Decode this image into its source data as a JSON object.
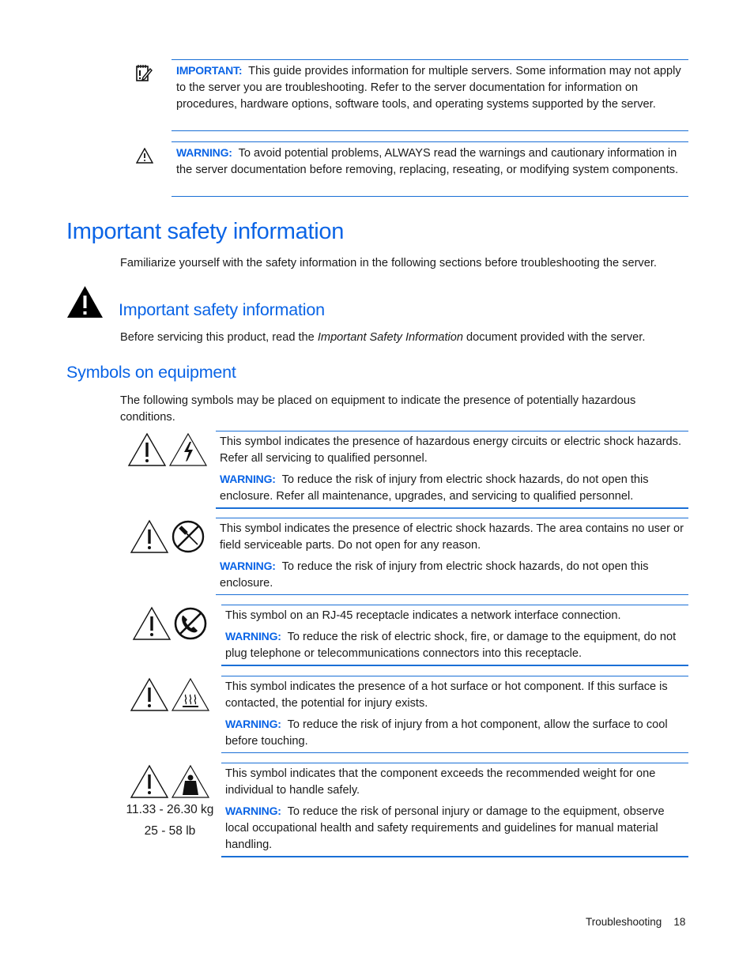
{
  "notes": [
    {
      "icon": "important-note-icon",
      "label": "IMPORTANT:",
      "text": "This guide provides information for multiple servers. Some information may not apply to the server you are troubleshooting. Refer to the server documentation for information on procedures, hardware options, software tools, and operating systems supported by the server."
    },
    {
      "icon": "warning-triangle-icon",
      "label": "WARNING:",
      "text": "To avoid potential problems, ALWAYS read the warnings and cautionary information in the server documentation before removing, replacing, reseating, or modifying system components."
    }
  ],
  "section": {
    "title": "Important safety information",
    "intro": "Familiarize yourself with the safety information in the following sections before troubleshooting the server."
  },
  "subsection_safety": {
    "title": "Important safety information",
    "text_before": "Before servicing this product, read the ",
    "text_italic": "Important Safety Information",
    "text_after": " document provided with the server."
  },
  "subsection_symbols": {
    "title": "Symbols on equipment",
    "intro": "The following symbols may be placed on equipment to indicate the presence of potentially hazardous conditions.",
    "items": [
      {
        "icons": [
          "exclamation-triangle-icon",
          "lightning-triangle-icon"
        ],
        "description": "This symbol indicates the presence of hazardous energy circuits or electric shock hazards. Refer all servicing to qualified personnel.",
        "warning_label": "WARNING:",
        "warning_text": "To reduce the risk of injury from electric shock hazards, do not open this enclosure. Refer all maintenance, upgrades, and servicing to qualified personnel."
      },
      {
        "icons": [
          "exclamation-triangle-icon",
          "no-screwdriver-icon"
        ],
        "description": "This symbol indicates the presence of electric shock hazards. The area contains no user or field serviceable parts. Do not open for any reason.",
        "warning_label": "WARNING:",
        "warning_text": "To reduce the risk of injury from electric shock hazards, do not open this enclosure."
      },
      {
        "icons": [
          "exclamation-triangle-icon",
          "no-telephone-icon"
        ],
        "description": "This symbol on an RJ-45 receptacle indicates a network interface connection.",
        "warning_label": "WARNING:",
        "warning_text": "To reduce the risk of electric shock, fire, or damage to the equipment, do not plug telephone or telecommunications connectors into this receptacle."
      },
      {
        "icons": [
          "exclamation-triangle-icon",
          "hot-surface-icon"
        ],
        "description": "This symbol indicates the presence of a hot surface or hot component. If this surface is contacted, the potential for injury exists.",
        "warning_label": "WARNING:",
        "warning_text": "To reduce the risk of injury from a hot component, allow the surface to cool before touching."
      },
      {
        "icons": [
          "exclamation-triangle-icon",
          "heavy-weight-icon"
        ],
        "weight_kg": "11.33 - 26.30 kg",
        "weight_lb": "25 - 58 lb",
        "description": "This symbol indicates that the component exceeds the recommended weight for one individual to handle safely.",
        "warning_label": "WARNING:",
        "warning_text": "To reduce the risk of personal injury or damage to the equipment, observe local occupational health and safety requirements and guidelines for manual material handling."
      }
    ]
  },
  "footer": {
    "chapter": "Troubleshooting",
    "page": "18"
  },
  "colors": {
    "accent_blue": "#0a64e6",
    "rule_blue": "#1a6fd6",
    "text": "#1a1a1a"
  }
}
